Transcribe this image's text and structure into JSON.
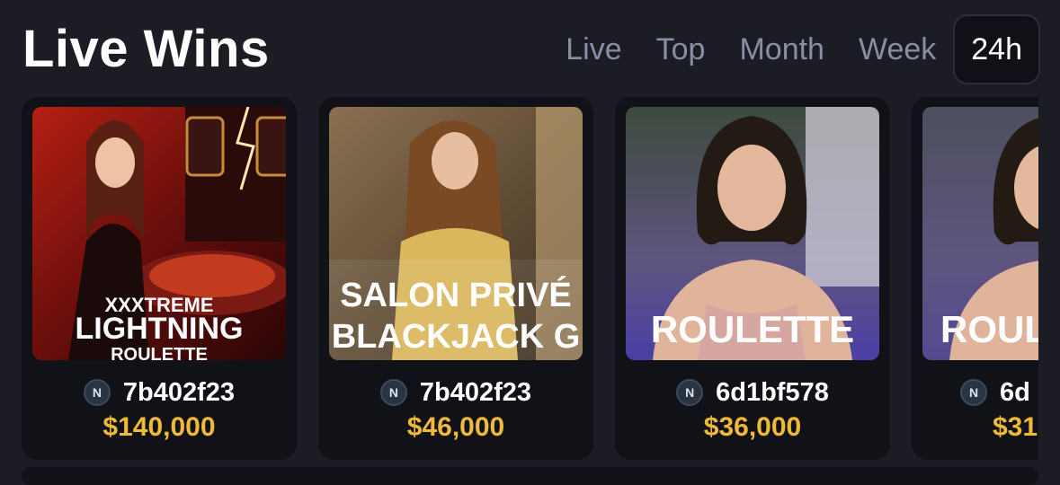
{
  "header": {
    "title": "Live Wins",
    "tabs": [
      {
        "label": "Live",
        "active": false
      },
      {
        "label": "Top",
        "active": false
      },
      {
        "label": "Month",
        "active": false
      },
      {
        "label": "Week",
        "active": false
      },
      {
        "label": "24h",
        "active": true
      }
    ]
  },
  "cards": [
    {
      "game_lines": [
        "XXXTREME",
        "LIGHTNING",
        "ROULETTE"
      ],
      "user": "7b402f23",
      "amount": "$140,000",
      "thumb_colors": {
        "bg": "#7a1010",
        "accent": "#e23b1c"
      }
    },
    {
      "game_lines": [
        "SALON PRIVÉ",
        "BLACKJACK G"
      ],
      "user": "7b402f23",
      "amount": "$46,000",
      "thumb_colors": {
        "bg": "#6e5a3c",
        "accent": "#d6b76a"
      }
    },
    {
      "game_lines": [
        "ROULETTE"
      ],
      "user": "6d1bf578",
      "amount": "$36,000",
      "thumb_colors": {
        "bg": "#4a4f86",
        "accent": "#c9a6a0"
      }
    },
    {
      "game_lines": [
        "ROUL"
      ],
      "user": "6d",
      "amount": "$31",
      "thumb_colors": {
        "bg": "#4a4f86",
        "accent": "#c9a6a0"
      }
    }
  ],
  "badge_icon": "nm-logo-icon",
  "badge_text": "N",
  "colors": {
    "background": "#1b1c24",
    "card": "#111217",
    "amount": "#f0b937",
    "tab_inactive": "#8a8ea3"
  }
}
